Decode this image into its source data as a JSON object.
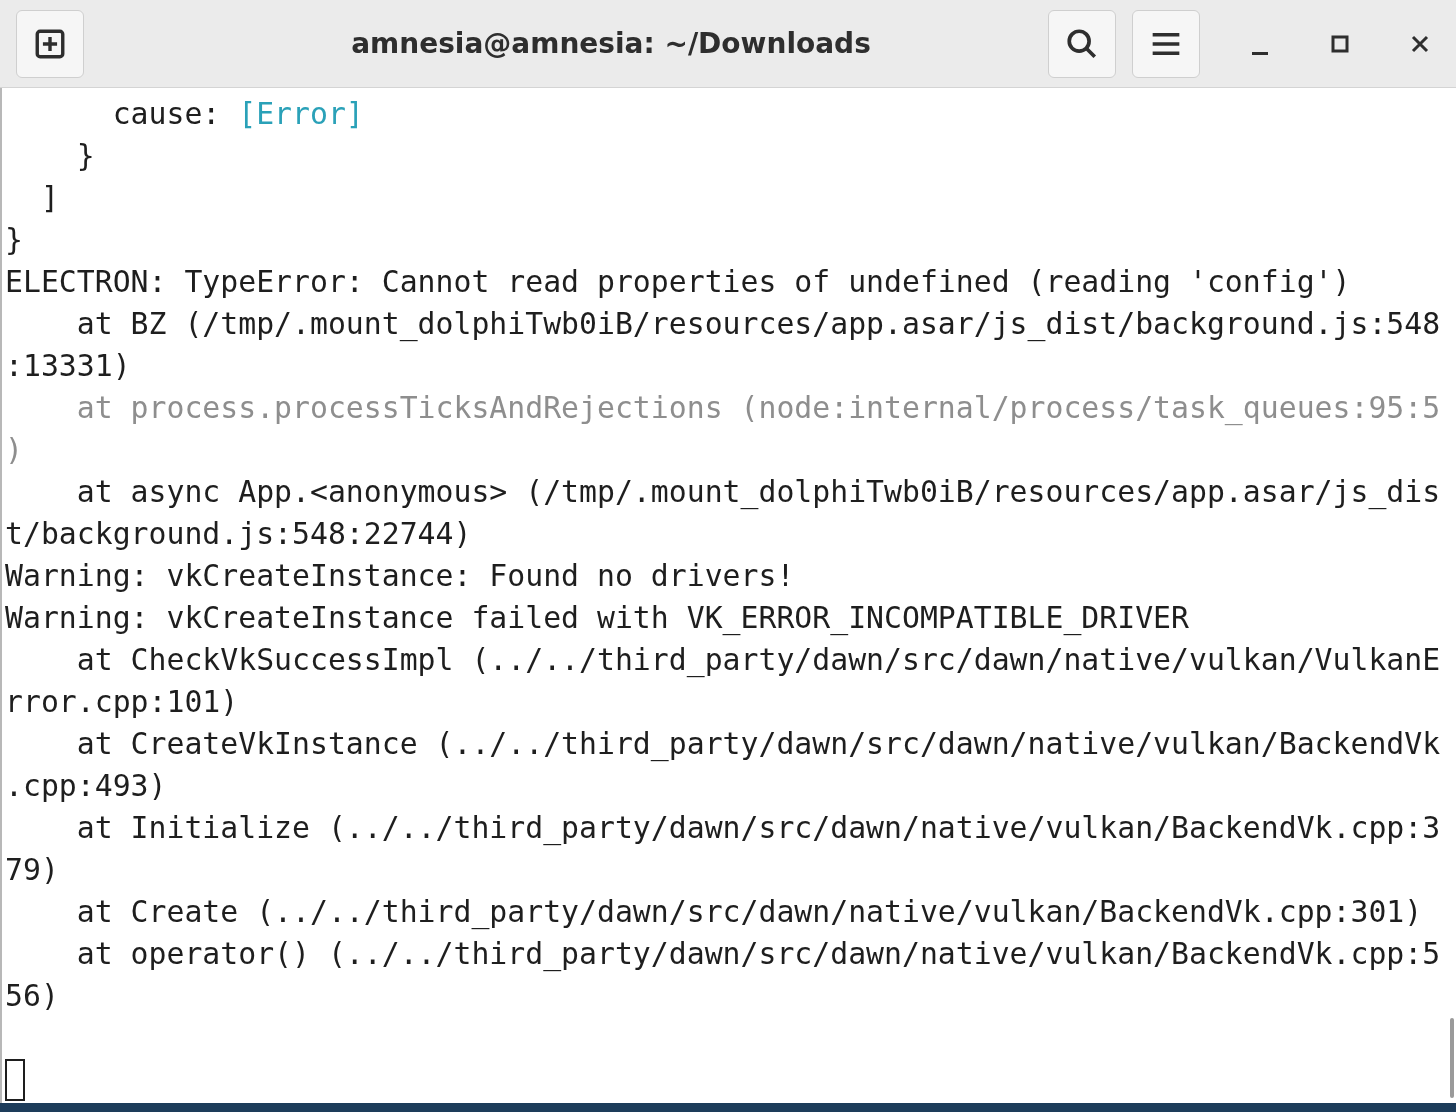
{
  "window": {
    "title": "amnesia@amnesia: ~/Downloads"
  },
  "terminal": {
    "rows": [
      {
        "segments": [
          {
            "text": "      cause: ",
            "kind": "normal"
          },
          {
            "text": "[Error]",
            "kind": "link"
          }
        ]
      },
      {
        "segments": [
          {
            "text": "    }",
            "kind": "normal"
          }
        ]
      },
      {
        "segments": [
          {
            "text": "  ]",
            "kind": "normal"
          }
        ]
      },
      {
        "segments": [
          {
            "text": "}",
            "kind": "normal"
          }
        ]
      },
      {
        "segments": [
          {
            "text": "ELECTRON: TypeError: Cannot read properties of undefined (reading 'config')",
            "kind": "normal"
          }
        ]
      },
      {
        "segments": [
          {
            "text": "    at BZ (/tmp/.mount_dolphiTwb0iB/resources/app.asar/js_dist/background.js:548",
            "kind": "normal"
          }
        ]
      },
      {
        "segments": [
          {
            "text": ":13331)",
            "kind": "normal"
          }
        ]
      },
      {
        "segments": [
          {
            "text": "    at process.processTicksAndRejections (node:internal/process/task_queues:95:5",
            "kind": "dim"
          }
        ]
      },
      {
        "segments": [
          {
            "text": ")",
            "kind": "dim"
          }
        ]
      },
      {
        "segments": [
          {
            "text": "    at async App.<anonymous> (/tmp/.mount_dolphiTwb0iB/resources/app.asar/js_dis",
            "kind": "normal"
          }
        ]
      },
      {
        "segments": [
          {
            "text": "t/background.js:548:22744)",
            "kind": "normal"
          }
        ]
      },
      {
        "segments": [
          {
            "text": "Warning: vkCreateInstance: Found no drivers!",
            "kind": "normal"
          }
        ]
      },
      {
        "segments": [
          {
            "text": "Warning: vkCreateInstance failed with VK_ERROR_INCOMPATIBLE_DRIVER",
            "kind": "normal"
          }
        ]
      },
      {
        "segments": [
          {
            "text": "    at CheckVkSuccessImpl (../../third_party/dawn/src/dawn/native/vulkan/VulkanE",
            "kind": "normal"
          }
        ]
      },
      {
        "segments": [
          {
            "text": "rror.cpp:101)",
            "kind": "normal"
          }
        ]
      },
      {
        "segments": [
          {
            "text": "    at CreateVkInstance (../../third_party/dawn/src/dawn/native/vulkan/BackendVk",
            "kind": "normal"
          }
        ]
      },
      {
        "segments": [
          {
            "text": ".cpp:493)",
            "kind": "normal"
          }
        ]
      },
      {
        "segments": [
          {
            "text": "    at Initialize (../../third_party/dawn/src/dawn/native/vulkan/BackendVk.cpp:3",
            "kind": "normal"
          }
        ]
      },
      {
        "segments": [
          {
            "text": "79)",
            "kind": "normal"
          }
        ]
      },
      {
        "segments": [
          {
            "text": "    at Create (../../third_party/dawn/src/dawn/native/vulkan/BackendVk.cpp:301)",
            "kind": "normal"
          }
        ]
      },
      {
        "segments": [
          {
            "text": "    at operator() (../../third_party/dawn/src/dawn/native/vulkan/BackendVk.cpp:5",
            "kind": "normal"
          }
        ]
      },
      {
        "segments": [
          {
            "text": "56)",
            "kind": "normal"
          }
        ]
      }
    ]
  }
}
